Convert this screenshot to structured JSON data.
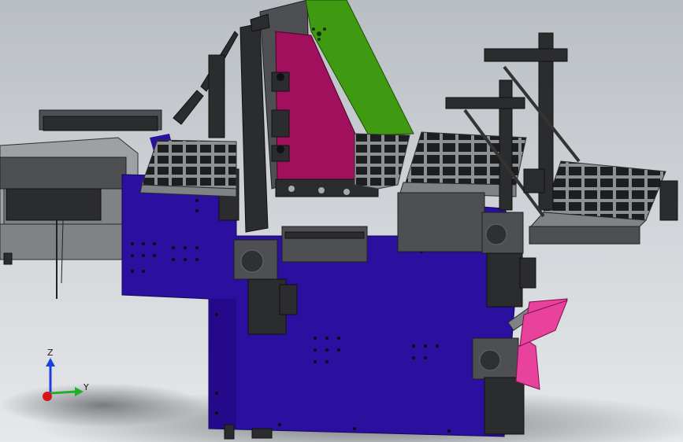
{
  "viewport": {
    "background_top": "#b9bec4",
    "background_bottom": "#e6e8ea"
  },
  "model": {
    "frame_color": "#2b0f9e",
    "panel_green_color": "#3f9a12",
    "panel_magenta_color": "#a0105c",
    "panel_pink_color": "#e8429c",
    "motor_color": "#3b3c3e",
    "tray_color": "#1d1e20",
    "feeder_grey_color": "#8a8e91"
  },
  "triad": {
    "z_label": "Z",
    "y_label": "Y",
    "z_color": "#1c3fe0",
    "y_color": "#22b02a",
    "x_color": "#d8141b",
    "icon": "coordinate-triad-icon"
  }
}
